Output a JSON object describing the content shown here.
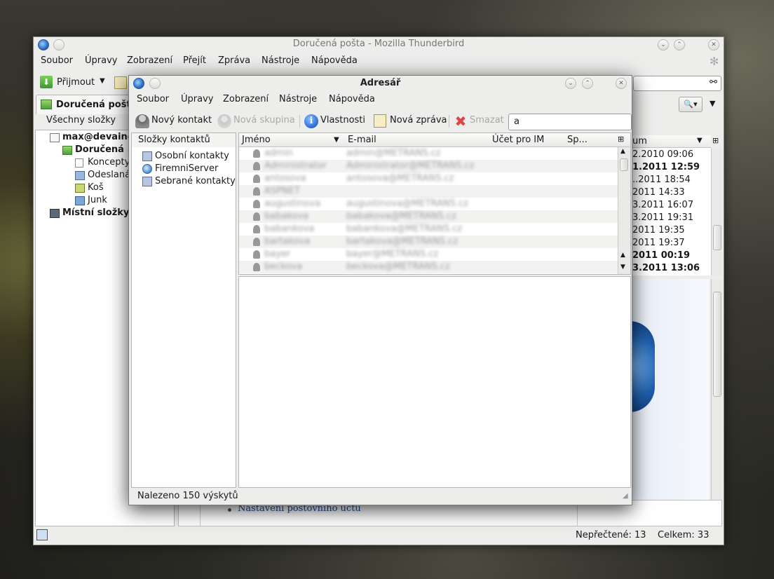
{
  "thunderbird": {
    "title": "Doručená pošta - Mozilla Thunderbird",
    "menu": [
      "Soubor",
      "Úpravy",
      "Zobrazení",
      "Přejít",
      "Zpráva",
      "Nástroje",
      "Nápověda"
    ],
    "receive_label": "Přijmout",
    "tab_label": "Doručená pošta",
    "all_folders_label": "Všechny složky",
    "folders": {
      "account": "max@devaine",
      "inbox": "Doručená ...",
      "drafts": "Koncepty",
      "sent": "Odeslaná",
      "trash": "Koš",
      "junk": "Junk",
      "local": "Místní složky"
    },
    "date_header": "um",
    "dates": [
      {
        "text": "2.2010 09:06",
        "bold": false
      },
      {
        "text": "1.2011 12:59",
        "bold": true
      },
      {
        "text": "..2011 18:54",
        "bold": false
      },
      {
        "text": "2011 14:33",
        "bold": false
      },
      {
        "text": "3.2011 16:07",
        "bold": false
      },
      {
        "text": "3.2011 19:31",
        "bold": false
      },
      {
        "text": "2011 19:35",
        "bold": false
      },
      {
        "text": "2011 19:37",
        "bold": false
      },
      {
        "text": "2011 00:19",
        "bold": true
      },
      {
        "text": "3.2011 13:06",
        "bold": true
      }
    ],
    "account_setup_link": "Nastavení poštovního účtu",
    "unread": "Nepřečtené: 13",
    "total": "Celkem: 33"
  },
  "addressbook": {
    "title": "Adresář",
    "menu": [
      "Soubor",
      "Úpravy",
      "Zobrazení",
      "Nástroje",
      "Nápověda"
    ],
    "toolbar": {
      "new_contact": "Nový kontakt",
      "new_group": "Nová skupina",
      "properties": "Vlastnosti",
      "new_message": "Nová zpráva",
      "delete": "Smazat"
    },
    "search_value": "a",
    "directories_header": "Složky kontaktů",
    "directories": [
      "Osobní kontakty",
      "FiremniServer",
      "Sebrané kontakty"
    ],
    "columns": {
      "name": "Jméno",
      "email": "E-mail",
      "im": "Účet pro IM",
      "sp": "Sp..."
    },
    "contacts": [
      {
        "name": "admin",
        "email": "admin@METRANS.cz"
      },
      {
        "name": "Administrator",
        "email": "Administrator@METRANS.cz"
      },
      {
        "name": "antosova",
        "email": "antosova@METRANS.cz"
      },
      {
        "name": "ASPNET",
        "email": ""
      },
      {
        "name": "augustinova",
        "email": "augustinova@METRANS.cz"
      },
      {
        "name": "babakova",
        "email": "babakova@METRANS.cz"
      },
      {
        "name": "babankova",
        "email": "babankova@METRANS.cz"
      },
      {
        "name": "bartakova",
        "email": "bartakova@METRANS.cz"
      },
      {
        "name": "bayer",
        "email": "bayer@METRANS.cz"
      },
      {
        "name": "beckova",
        "email": "beckova@METRANS.cz"
      }
    ],
    "status": "Nalezeno 150 výskytů"
  }
}
